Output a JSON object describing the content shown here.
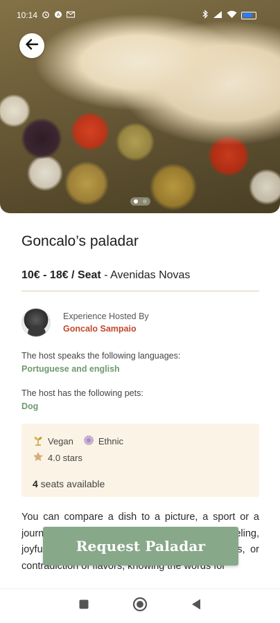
{
  "status_bar": {
    "time": "10:14"
  },
  "hero": {
    "image_alt": "cod fish with potatoes, tomatoes and olives",
    "carousel_pages": 2,
    "carousel_active": 1
  },
  "listing": {
    "title": "Goncalo’s paladar",
    "price_range": "10€ - 18€ / Seat",
    "price_separator": " - ",
    "neighborhood": "Avenidas Novas"
  },
  "host": {
    "hosted_by_label": "Experience Hosted By",
    "name": "Goncalo Sampaio"
  },
  "languages": {
    "label": "The host speaks the following languages:",
    "value": "Portuguese and english"
  },
  "pets": {
    "label": "The host has the following pets:",
    "value": "Dog"
  },
  "info": {
    "tags": [
      {
        "label": "Vegan",
        "icon": "sprout-icon"
      },
      {
        "label": "Ethnic",
        "icon": "globe-icon"
      }
    ],
    "rating_text": "4.0 stars",
    "seats_count": "4",
    "seats_label": " seats available"
  },
  "description": "You can compare a dish to a picture, a sport or a journey, but giving the name of a mood or feeling, joyful or sombre mood, shyness, assertiveness, or contradiction of flavors, knowing the words for",
  "actions": {
    "request_label": "Request Paladar"
  },
  "colors": {
    "accent_green": "#87a889",
    "host_name": "#c1492b",
    "info_box_bg": "#fbf4e6"
  }
}
